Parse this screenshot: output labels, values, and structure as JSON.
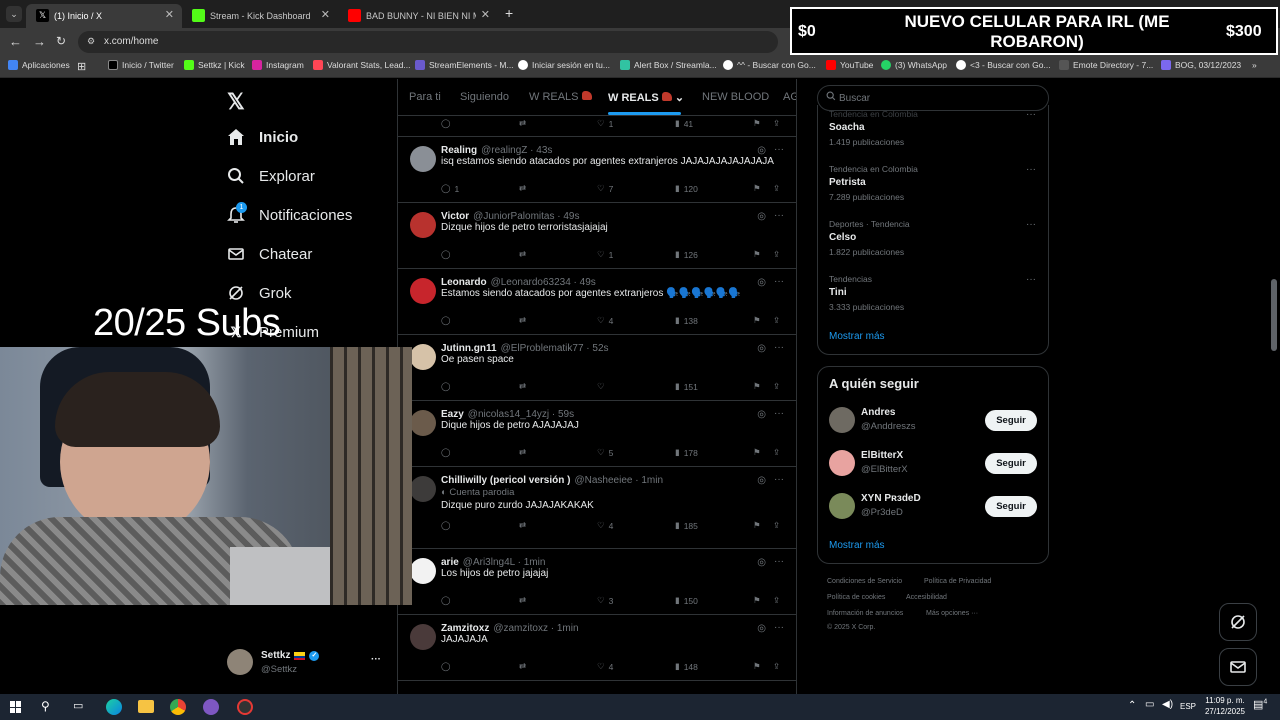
{
  "browser": {
    "tabs": [
      {
        "label": "(1) Inicio / X",
        "active": true
      },
      {
        "label": "Stream - Kick Dashboard",
        "active": false
      },
      {
        "label": "BAD BUNNY - NI BIEN NI MAL",
        "active": false
      }
    ],
    "url": "x.com/home",
    "bookmarks": [
      "Aplicaciones",
      "Inicio / Twitter",
      "Settkz | Kick",
      "Instagram",
      "Valorant Stats, Lead...",
      "StreamElements - M...",
      "Iniciar sesión en tu...",
      "Alert Box / Streamla...",
      "^^ - Buscar con Go...",
      "YouTube",
      "(3) WhatsApp",
      "<3 - Buscar con Go...",
      "Emote Directory - 7...",
      "BOG, 03/12/2023"
    ]
  },
  "overlay": {
    "left_amount": "$0",
    "headline": "NUEVO CELULAR PARA IRL (ME ROBARON)",
    "right_amount": "$300"
  },
  "nav": {
    "items": [
      "Inicio",
      "Explorar",
      "Notificaciones",
      "Chatear",
      "Grok",
      "Premium"
    ],
    "notif_badge": "1",
    "profile_name": "Settkz",
    "profile_handle": "@Settkz",
    "more": "···"
  },
  "subs_text": "20/25 Subs",
  "feed": {
    "tabs": [
      "Para ti",
      "Siguiendo",
      "W REALS",
      "W REALS",
      "NEW BLOOD",
      "AG"
    ],
    "top_actions": {
      "likes": "1",
      "views": "41"
    },
    "tweets": [
      {
        "name": "Realing",
        "handle": "@realingZ · 43s",
        "text": "isq estamos siendo atacados por agentes extranjeros JAJAJAJAJAJAJAJA",
        "replies": "1",
        "retweets": "",
        "likes": "7",
        "views": "120",
        "avatar": "#8a8f96"
      },
      {
        "name": "Victor",
        "handle": "@JuniorPalomitas · 49s",
        "text": "Dizque hijos de petro terroristasjajajaj",
        "replies": "",
        "retweets": "",
        "likes": "1",
        "views": "126",
        "avatar": "#b8322e"
      },
      {
        "name": "Leonardo",
        "handle": "@Leonardo63234 · 49s",
        "text": "Estamos siendo atacados por agentes extranjeros 🗣️🗣️🗣️🗣️🗣️🗣️",
        "replies": "",
        "retweets": "",
        "likes": "4",
        "views": "138",
        "avatar": "#c7252c"
      },
      {
        "name": "Jutinn.gn11",
        "handle": "@ElProblematik77 · 52s",
        "text": "Oe pasen space",
        "replies": "",
        "retweets": "",
        "likes": "",
        "views": "151",
        "avatar": "#d6c2a8"
      },
      {
        "name": "Eazy",
        "handle": "@nicolas14_14yzj · 59s",
        "text": "Dique hijos de petro AJAJAJAJ",
        "replies": "",
        "retweets": "",
        "likes": "5",
        "views": "178",
        "avatar": "#6b5b4b"
      },
      {
        "name": "Chilliwilly (pericol versión )",
        "handle": "@Nasheeiee · 1min",
        "sub": "Cuenta parodia",
        "text": "Dizque puro zurdo JAJAJAKAKAK",
        "replies": "",
        "retweets": "",
        "likes": "4",
        "views": "185",
        "avatar": "#3d3b3a"
      },
      {
        "name": "arie",
        "handle": "@Ari3lng4L · 1min",
        "text": "Los hijos de petro jajajaj",
        "replies": "",
        "retweets": "",
        "likes": "3",
        "views": "150",
        "avatar": "#f2f2f2"
      },
      {
        "name": "Zamzitoxz",
        "handle": "@zamzitoxz · 1min",
        "text": "JAJAJAJA",
        "replies": "",
        "retweets": "",
        "likes": "4",
        "views": "148",
        "avatar": "#4a3a3a"
      }
    ]
  },
  "search": {
    "placeholder": "Buscar"
  },
  "trends": {
    "items": [
      {
        "category": "Tendencia en Colombia",
        "title": "Soacha",
        "count": "1.419 publicaciones"
      },
      {
        "category": "Tendencia en Colombia",
        "title": "Petrista",
        "count": "7.289 publicaciones"
      },
      {
        "category": "Deportes · Tendencia",
        "title": "Celso",
        "count": "1.822 publicaciones"
      },
      {
        "category": "Tendencias",
        "title": "Tini",
        "count": "3.333 publicaciones"
      }
    ],
    "show_more": "Mostrar más"
  },
  "follow": {
    "heading": "A quién seguir",
    "users": [
      {
        "name": "Andres",
        "handle": "@Anddreszs",
        "button": "Seguir",
        "avatar": "#6e6a62"
      },
      {
        "name": "ElBitterX",
        "handle": "@ElBitterX",
        "button": "Seguir",
        "avatar": "#e8a3a0"
      },
      {
        "name": "XYN PʀɜdeD",
        "handle": "@Pr3deD",
        "button": "Seguir",
        "avatar": "#7a8a5a"
      }
    ],
    "show_more": "Mostrar más"
  },
  "footer": {
    "links": [
      "Condiciones de Servicio",
      "Política de Privacidad",
      "Política de cookies",
      "Accesibilidad",
      "Información de anuncios",
      "Más opciones ···"
    ],
    "copyright": "© 2025 X Corp."
  },
  "taskbar": {
    "lang": "ESP",
    "time": "11:09 p. m.",
    "date": "27/12/2025",
    "notif": "4"
  },
  "colors": {
    "accent": "#1d9bf0",
    "bg": "#000000",
    "border": "#2f3336",
    "muted": "#71767b"
  }
}
